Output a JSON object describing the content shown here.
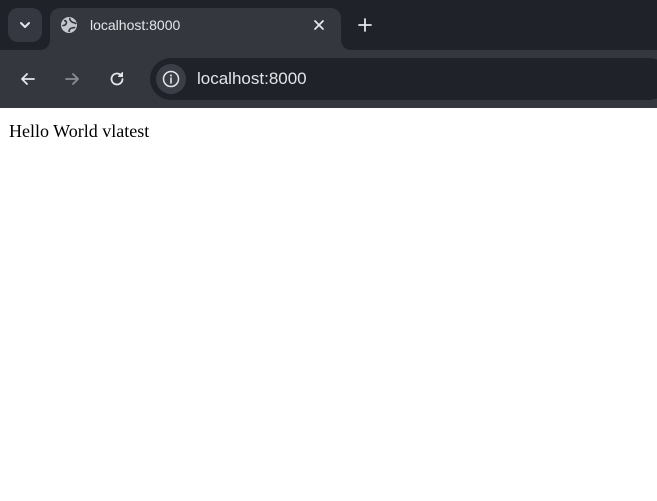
{
  "browser": {
    "tab": {
      "title": "localhost:8000",
      "favicon": "globe-icon"
    },
    "tabstrip": {
      "search_icon": "chevron-down-icon",
      "new_tab_icon": "plus-icon",
      "close_icon": "close-icon"
    },
    "toolbar": {
      "back_icon": "arrow-left-icon",
      "forward_icon": "arrow-right-icon",
      "reload_icon": "reload-icon",
      "site_info_icon": "info-icon",
      "url": "localhost:8000"
    },
    "colors": {
      "tabstrip_bg": "#1f2229",
      "active_tab_bg": "#35373f",
      "omnibox_bg": "#1f2229",
      "text_light": "#e4e6ea",
      "page_bg": "#ffffff"
    }
  },
  "page": {
    "body_text": "Hello World vlatest"
  }
}
